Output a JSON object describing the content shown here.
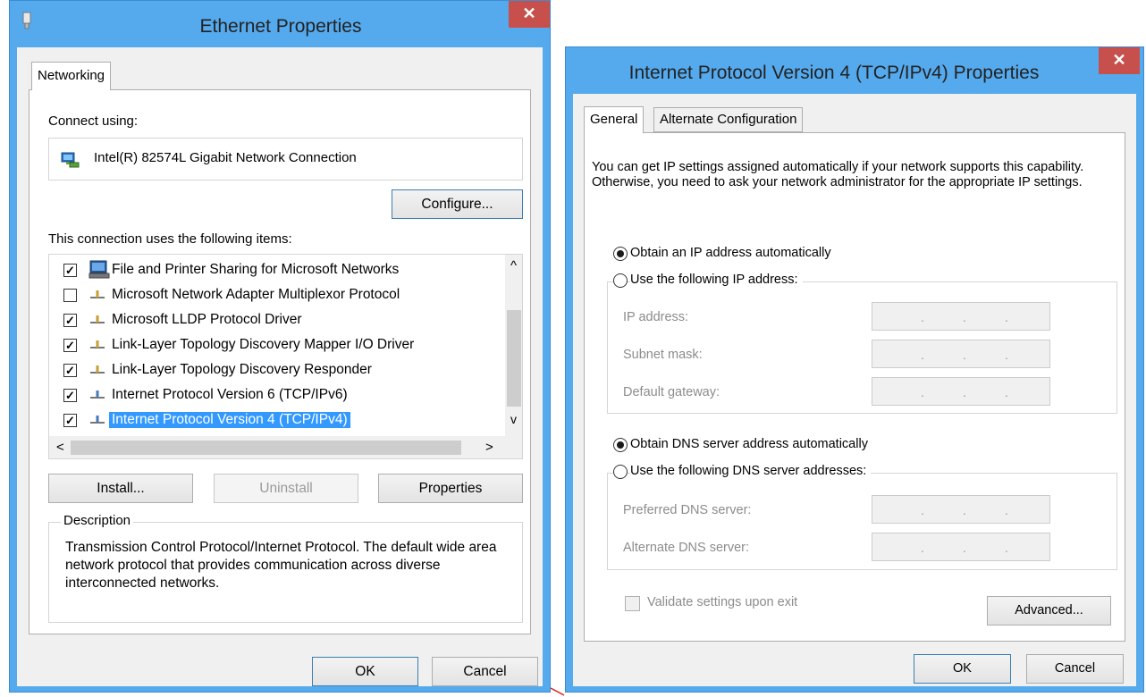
{
  "left_window": {
    "title": "Ethernet Properties",
    "close_glyph": "✕",
    "tab": "Networking",
    "connect_using_label": "Connect using:",
    "adapter_name": "Intel(R) 82574L Gigabit Network Connection",
    "configure_label": "Configure...",
    "items_label": "This connection uses the following items:",
    "items": [
      {
        "label": "File and Printer Sharing for Microsoft Networks",
        "checked": true,
        "check": "✓",
        "icon": "computer-icon"
      },
      {
        "label": "Microsoft Network Adapter Multiplexor Protocol",
        "checked": false,
        "check": "",
        "icon": "protocol-icon"
      },
      {
        "label": "Microsoft LLDP Protocol Driver",
        "checked": true,
        "check": "✓",
        "icon": "protocol-icon"
      },
      {
        "label": "Link-Layer Topology Discovery Mapper I/O Driver",
        "checked": true,
        "check": "✓",
        "icon": "protocol-icon"
      },
      {
        "label": "Link-Layer Topology Discovery Responder",
        "checked": true,
        "check": "✓",
        "icon": "protocol-icon"
      },
      {
        "label": "Internet Protocol Version 6 (TCP/IPv6)",
        "checked": true,
        "check": "✓",
        "icon": "protocol-icon"
      },
      {
        "label": "Internet Protocol Version 4 (TCP/IPv4)",
        "checked": true,
        "check": "✓",
        "icon": "protocol-icon",
        "selected": true
      }
    ],
    "scroll_up": "^",
    "scroll_down": "v",
    "scroll_left": "<",
    "scroll_right": ">",
    "install_label": "Install...",
    "uninstall_label": "Uninstall",
    "properties_label": "Properties",
    "description_label": "Description",
    "description_text": "Transmission Control Protocol/Internet Protocol. The default wide area network protocol that provides communication across diverse interconnected networks.",
    "ok_label": "OK",
    "cancel_label": "Cancel"
  },
  "right_window": {
    "title": "Internet Protocol Version 4 (TCP/IPv4) Properties",
    "close_glyph": "✕",
    "tabs": [
      "General",
      "Alternate Configuration"
    ],
    "intro_text": "You can get IP settings assigned automatically if your network supports this capability. Otherwise, you need to ask your network administrator for the appropriate IP settings.",
    "obtain_ip_auto": "Obtain an IP address automatically",
    "use_following_ip": "Use the following IP address:",
    "ip_address_label": "IP address:",
    "subnet_mask_label": "Subnet mask:",
    "default_gateway_label": "Default gateway:",
    "obtain_dns_auto": "Obtain DNS server address automatically",
    "use_following_dns": "Use the following DNS server addresses:",
    "preferred_dns_label": "Preferred DNS server:",
    "alternate_dns_label": "Alternate DNS server:",
    "ip_dot": ".",
    "validate_label": "Validate settings upon exit",
    "advanced_label": "Advanced...",
    "ok_label": "OK",
    "cancel_label": "Cancel"
  },
  "colors": {
    "title_bar": "#55aaee",
    "close_button": "#c7504c",
    "selection": "#3399ff"
  }
}
